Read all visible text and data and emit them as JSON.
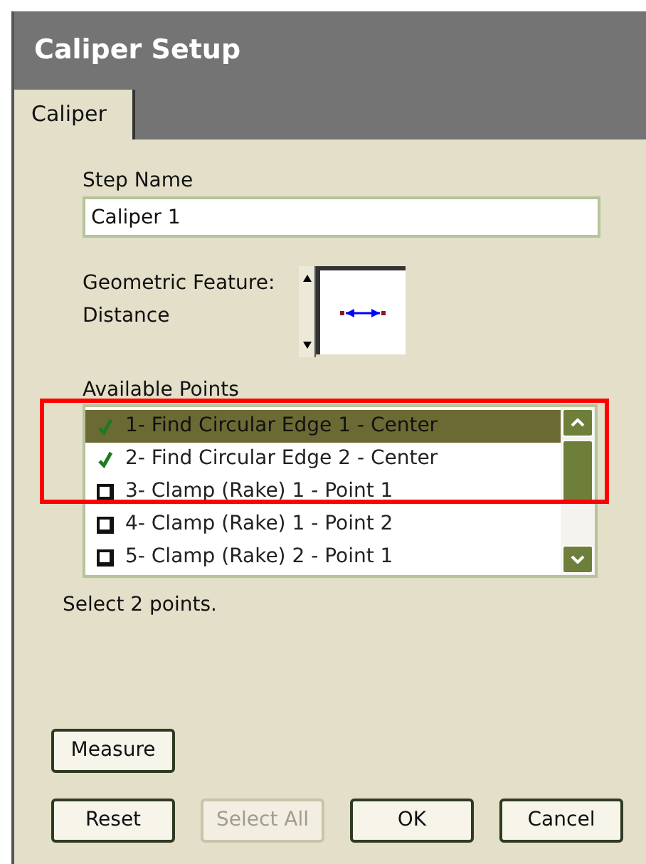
{
  "window": {
    "title": "Caliper Setup"
  },
  "tabs": [
    {
      "label": "Caliper",
      "selected": true
    }
  ],
  "step_name": {
    "label": "Step Name",
    "value": "Caliper 1"
  },
  "geometric_feature": {
    "label": "Geometric Feature:",
    "value": "Distance"
  },
  "available_points": {
    "label": "Available Points",
    "items": [
      {
        "label": "1- Find Circular Edge 1 - Center",
        "checked": true,
        "selected": true
      },
      {
        "label": "2- Find Circular Edge 2 - Center",
        "checked": true,
        "selected": false
      },
      {
        "label": "3- Clamp (Rake) 1 - Point 1",
        "checked": false,
        "selected": false
      },
      {
        "label": "4- Clamp (Rake) 1 - Point 2",
        "checked": false,
        "selected": false
      },
      {
        "label": "5- Clamp (Rake) 2 - Point 1",
        "checked": false,
        "selected": false
      }
    ]
  },
  "hint": "Select 2 points.",
  "measure_button": {
    "label": "Measure"
  },
  "buttons": [
    {
      "label": "Reset",
      "disabled": false
    },
    {
      "label": "Select All",
      "disabled": true
    },
    {
      "label": "OK",
      "disabled": false
    },
    {
      "label": "Cancel",
      "disabled": false
    }
  ]
}
